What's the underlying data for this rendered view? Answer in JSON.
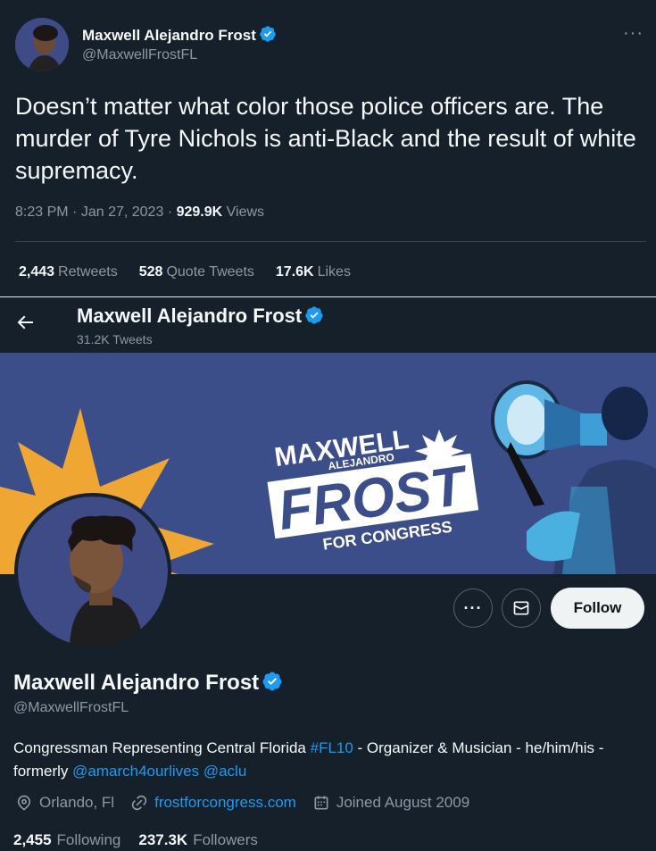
{
  "tweet": {
    "author_name": "Maxwell Alejandro Frost",
    "author_handle": "@MaxwellFrostFL",
    "more_label": "···",
    "text": "Doesn’t matter what color those police officers are. The murder of Tyre Nichols is anti-Black and the result of white supremacy.",
    "time": "8:23 PM",
    "date": "Jan 27, 2023",
    "separator": "·",
    "views_count": "929.9K",
    "views_label": "Views",
    "retweets_count": "2,443",
    "retweets_label": "Retweets",
    "quotes_count": "528",
    "quotes_label": "Quote Tweets",
    "likes_count": "17.6K",
    "likes_label": "Likes"
  },
  "profile_header": {
    "name": "Maxwell Alejandro Frost",
    "tweets_count": "31.2K Tweets"
  },
  "banner": {
    "line1": "MAXWELL",
    "line2": "ALEJANDRO",
    "line3": "FROST",
    "line4": "FOR CONGRESS",
    "bg_color": "#3c4e8a",
    "star_color": "#f0a633"
  },
  "profile": {
    "name": "Maxwell Alejandro Frost",
    "handle": "@MaxwellFrostFL",
    "follow_label": "Follow",
    "bio_part1": "Congressman Representing Central Florida ",
    "bio_hashtag": "#FL10",
    "bio_part2": " - Organizer & Musician - he/him/his - formerly ",
    "bio_mention1": "@amarch4ourlives",
    "bio_space": " ",
    "bio_mention2": "@aclu",
    "location": "Orlando, Fl",
    "website": "frostforcongress.com",
    "joined": "Joined August 2009",
    "following_count": "2,455",
    "following_label": "Following",
    "followers_count": "237.3K",
    "followers_label": "Followers"
  },
  "colors": {
    "background": "#15202b",
    "accent": "#1d9bf0",
    "verified": "#1d9bf0"
  }
}
